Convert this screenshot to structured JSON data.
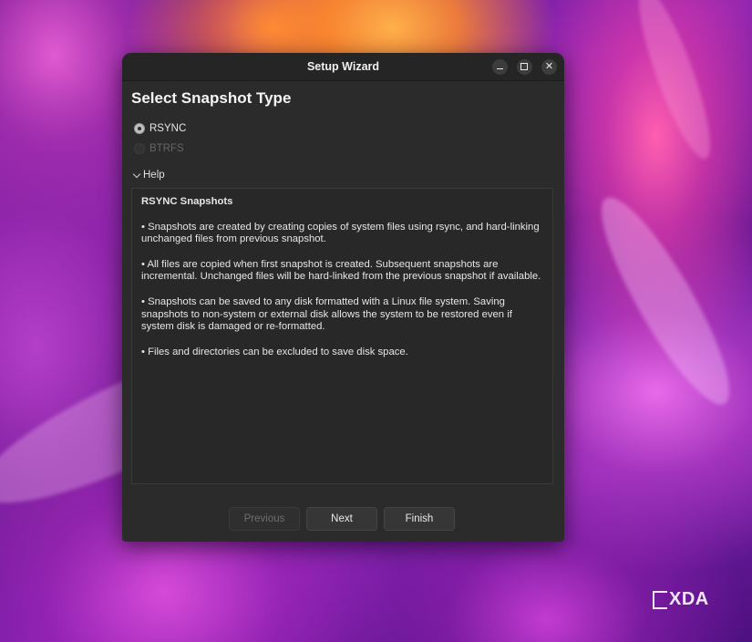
{
  "window": {
    "title": "Setup Wizard"
  },
  "heading": "Select Snapshot Type",
  "snapshot_types": [
    {
      "label": "RSYNC",
      "selected": true,
      "enabled": true
    },
    {
      "label": "BTRFS",
      "selected": false,
      "enabled": false
    }
  ],
  "help": {
    "toggle_label": "Help",
    "title": "RSYNC Snapshots",
    "paragraphs": [
      "• Snapshots are created by creating copies of system files using rsync, and hard-linking unchanged files from previous snapshot.",
      "• All files are copied when first snapshot is created. Subsequent snapshots are incremental. Unchanged files will be hard-linked from the previous snapshot if available.",
      "• Snapshots can be saved to any disk formatted with a Linux file system. Saving snapshots to non-system or external disk allows the system to be restored even if system disk is damaged or re-formatted.",
      "• Files and directories can be excluded to save disk space."
    ]
  },
  "buttons": {
    "previous": "Previous",
    "next": "Next",
    "finish": "Finish"
  },
  "watermark": "XDA"
}
